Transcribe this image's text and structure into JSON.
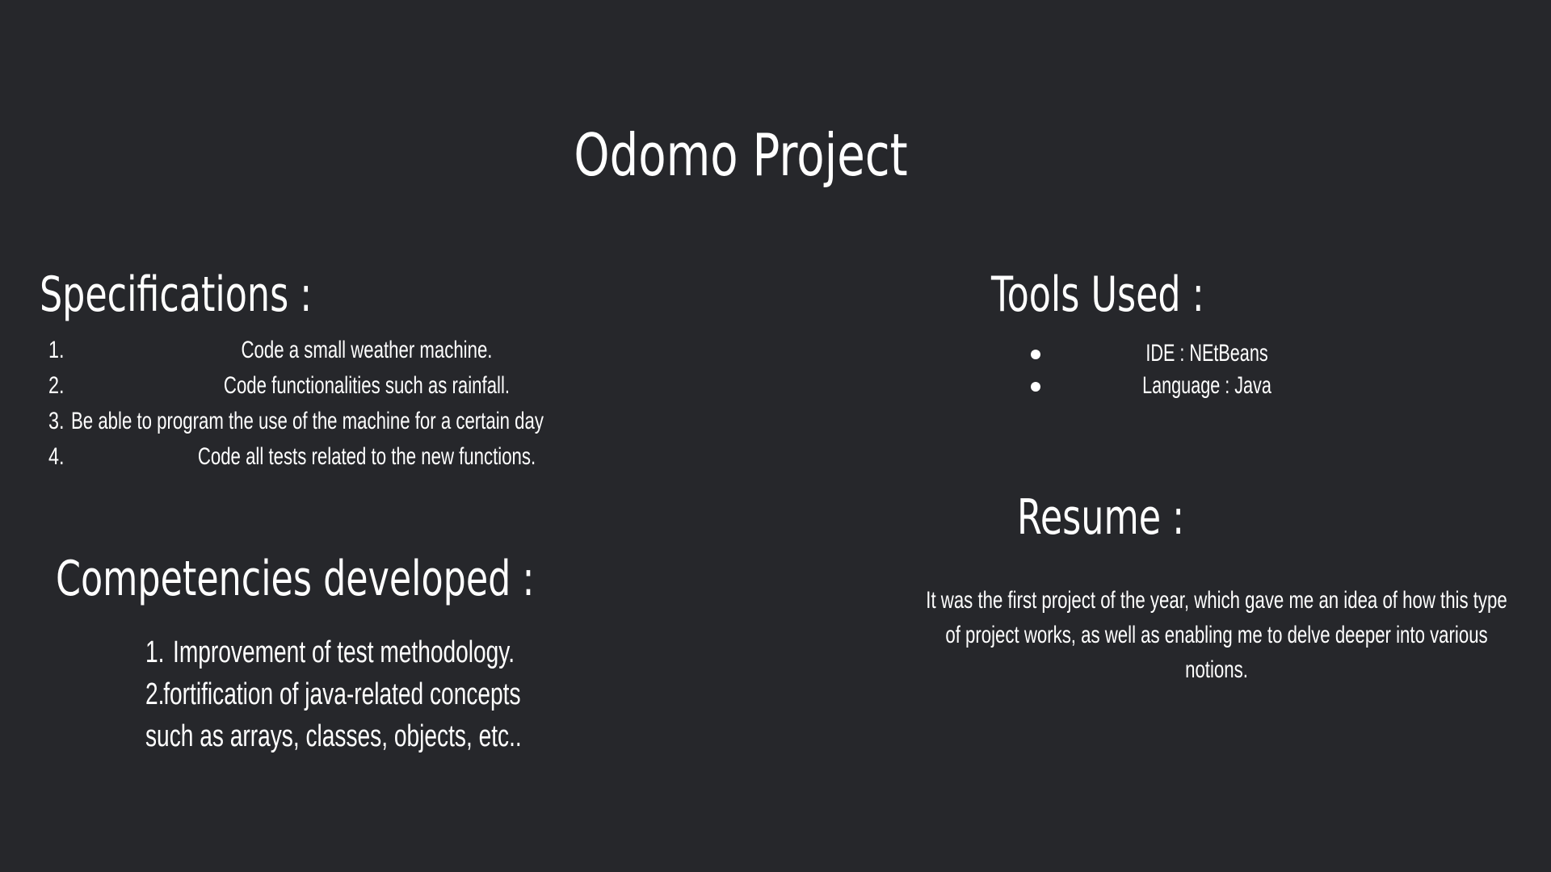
{
  "slide": {
    "background": "#26272b",
    "text_color": "#ffffff",
    "title": "Odomo Project"
  },
  "specifications": {
    "heading": "Specifications :",
    "items": [
      {
        "number": "1.",
        "text": "Code a small weather machine."
      },
      {
        "number": "2.",
        "text": "Code functionalities such as rainfall."
      },
      {
        "number": "3.",
        "text": "Be able to program the use of the machine for a certain day"
      },
      {
        "number": "4.",
        "text": "Code all tests related to the new functions."
      }
    ]
  },
  "tools": {
    "heading": "Tools Used :",
    "items": [
      {
        "text": "IDE : NEtBeans"
      },
      {
        "text": "Language : Java"
      }
    ],
    "bullet_icon": "bullet-dot"
  },
  "competencies": {
    "heading": "Competencies developed :",
    "lines": [
      {
        "number": "1.",
        "text": "Improvement of test methodology."
      },
      {
        "number": "2.",
        "text": "fortification of java-related concepts"
      },
      {
        "number": "",
        "text": "such as arrays, classes, objects, etc.."
      }
    ]
  },
  "resume": {
    "heading": "Resume :",
    "text": "It was the first project of the year, which gave me an idea of how this type of project works, as well as enabling me to delve deeper into various notions."
  }
}
